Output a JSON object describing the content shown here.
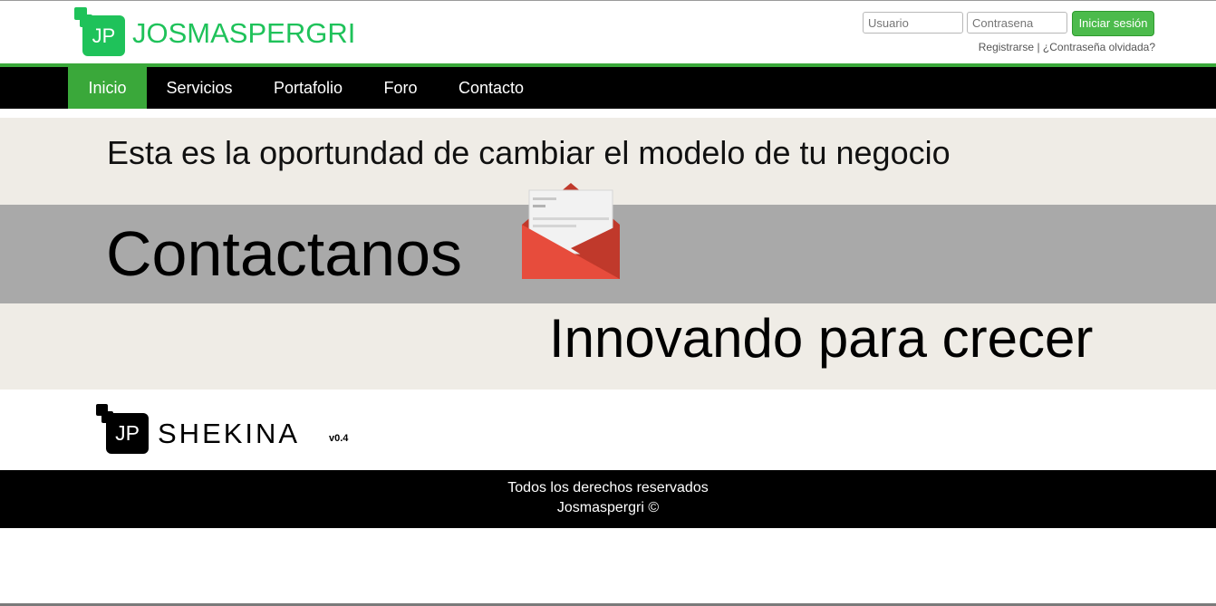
{
  "header": {
    "logo_initials": "JP",
    "brand": "JOSMASPERGRI",
    "brand_color": "#1fc25a",
    "login": {
      "user_placeholder": "Usuario",
      "password_placeholder": "Contrasena",
      "submit_label": "Iniciar sesión",
      "register_link": "Registrarse",
      "separator": "|",
      "forgot_link": "¿Contraseña olvidada?"
    }
  },
  "nav": {
    "items": [
      {
        "label": "Inicio",
        "active": true
      },
      {
        "label": "Servicios"
      },
      {
        "label": "Portafolio"
      },
      {
        "label": "Foro"
      },
      {
        "label": "Contacto"
      }
    ],
    "accent_color": "#3aa83a"
  },
  "hero": {
    "line1": "Esta es la oportundad de cambiar el modelo de tu negocio",
    "line2": "Contactanos",
    "line3": "Innovando para crecer",
    "icon": "envelope-icon"
  },
  "shekina": {
    "initials": "JP",
    "name": "SHEKINA",
    "version": "v0.4"
  },
  "footer": {
    "line1": "Todos los derechos reservados",
    "line2": "Josmaspergri ©"
  }
}
